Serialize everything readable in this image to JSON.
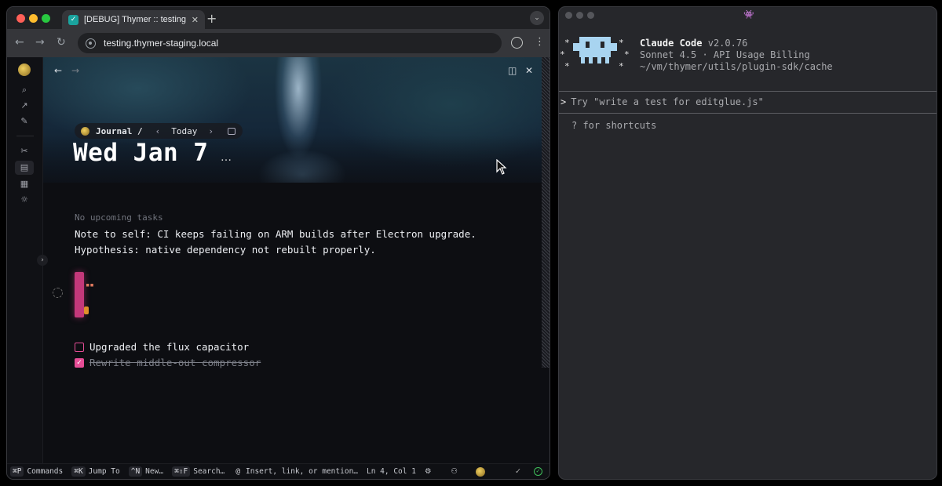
{
  "browser": {
    "tab_title": "[DEBUG] Thymer :: testing",
    "url": "testing.thymer-staging.local"
  },
  "journal": {
    "breadcrumb": "Journal /",
    "today_label": "Today",
    "date_title": "Wed Jan 7",
    "more": "…"
  },
  "content": {
    "no_tasks": "No upcoming tasks",
    "note_line1": "Note to self: CI keeps failing on ARM builds after Electron upgrade.",
    "note_line2": "Hypothesis: native dependency not rebuilt properly.",
    "tasks": [
      {
        "label": "Upgraded the flux capacitor",
        "checked": false
      },
      {
        "label": "Rewrite middle-out compressor",
        "checked": true
      }
    ]
  },
  "statusbar": {
    "items": [
      {
        "key": "⌘P",
        "label": "Commands"
      },
      {
        "key": "⌘K",
        "label": "Jump To"
      },
      {
        "key": "^N",
        "label": "New…"
      },
      {
        "key": "⌘⇧F",
        "label": "Search…"
      },
      {
        "key": "@",
        "label": "Insert, link, or mention…"
      }
    ],
    "position": "Ln 4, Col 1"
  },
  "terminal": {
    "app_name": "Claude Code",
    "version": "v2.0.76",
    "model_line": "Sonnet 4.5 · API Usage Billing",
    "path_line": "~/vm/thymer/utils/plugin-sdk/cache",
    "prompt_placeholder": "Try \"write a test for editglue.js\"",
    "shortcuts_hint": "? for shortcuts"
  },
  "colors": {
    "accent_pink": "#e64d96",
    "mascot_blue": "#a8d4f0",
    "status_ok": "#3fbf5a"
  }
}
